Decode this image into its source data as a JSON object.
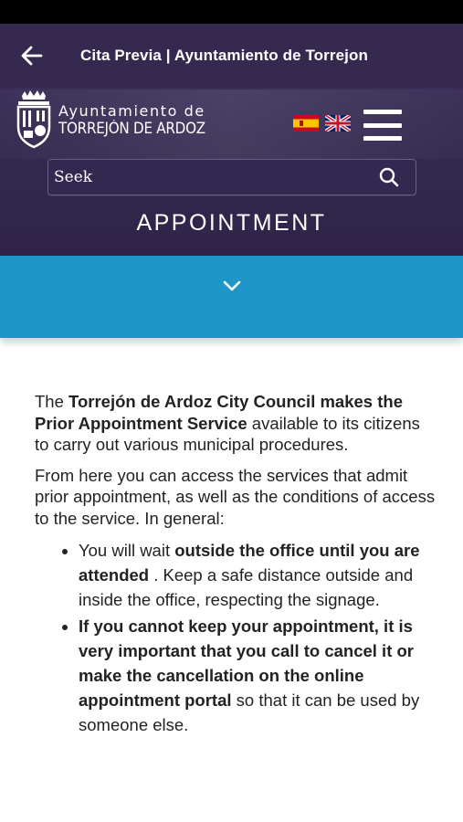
{
  "app_bar": {
    "title": "Cita Previa | Ayuntamiento de Torrejon"
  },
  "header": {
    "logo_line1": "Ayuntamiento de",
    "logo_line2": "TORREJÓN DE ARDOZ",
    "flags": [
      "spanish-flag",
      "uk-flag"
    ],
    "search": {
      "placeholder": "Seek"
    },
    "page_title": "APPOINTMENT"
  },
  "colors": {
    "header_bg": "#35294f",
    "accordion_bg": "#1e96c8",
    "text": "#222222"
  },
  "content": {
    "p1": {
      "prefix": "The ",
      "org": "Torrejón de Ardoz City Council",
      "bold_mid": " makes the Prior Appointment Service",
      "suffix": " available to its citizens  to carry  out various municipal procedures."
    },
    "p2": "From here you can access the services that admit prior appointment, as well as the conditions of access to the service. In general:",
    "bullets": [
      {
        "prefix": "You will wait ",
        "bold": "outside the office until you are attended",
        "suffix": " . Keep a safe distance outside and inside the office, respecting the signage."
      },
      {
        "prefix": "",
        "bold": "If you cannot keep your appointment, it is very important that you call to cancel it or make the cancellation on the online appointment portal",
        "suffix": "  so that it can be used by someone else."
      }
    ]
  }
}
